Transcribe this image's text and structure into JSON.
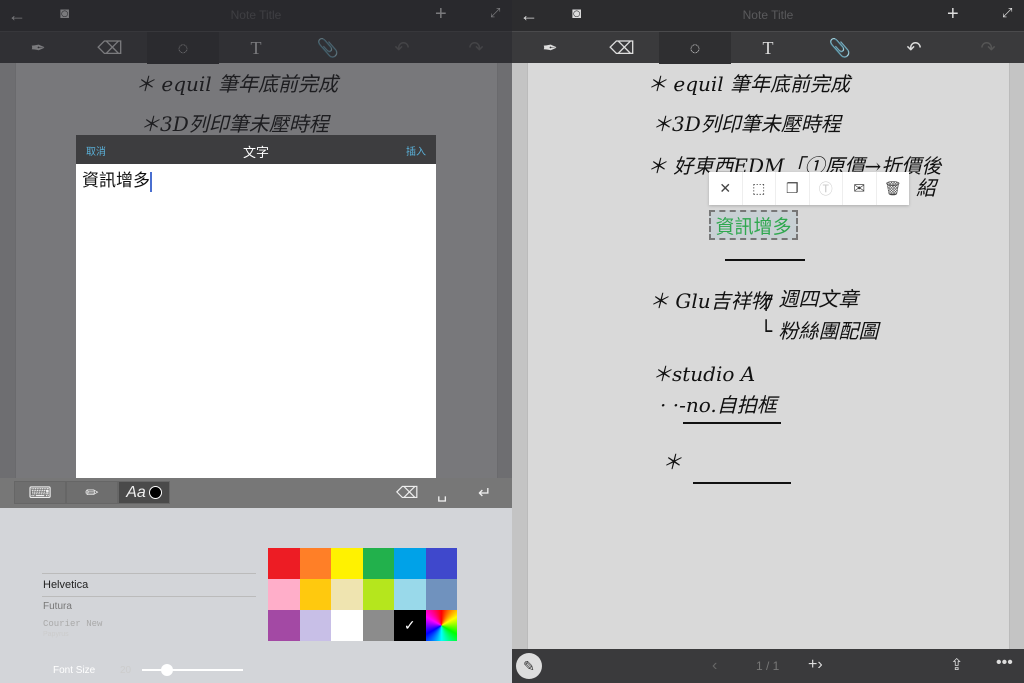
{
  "note_title": "Note Title",
  "toolbar": {
    "tools": [
      "pen-icon",
      "eraser-icon",
      "lasso-icon",
      "text-icon",
      "attach-icon",
      "undo-icon",
      "redo-icon"
    ]
  },
  "handwriting": {
    "line1": "＊ equil 筆年底前完成",
    "line2": "＊3D列印筆未壓時程",
    "line3": "＊ 好東西EDM「①原價→折價後",
    "line3b": "紹",
    "line4": "＊ Glu吉祥物",
    "line4a": "┌ 週四文章",
    "line4b": "└ 粉絲團配圖",
    "line5": "＊studio A",
    "line6": "· ·-no.自拍框",
    "line7": "＊"
  },
  "inserted_text": "資訊增多",
  "dialog": {
    "cancel": "取消",
    "title": "文字",
    "insert": "插入",
    "value": "資訊增多"
  },
  "keyboard_bar": {
    "font_label": "Aa"
  },
  "fonts": [
    "Helvetica",
    "Futura",
    "Courier New",
    "Papyrus"
  ],
  "font_size": {
    "label": "Font Size",
    "value": "20",
    "fraction": 0.25
  },
  "colors": [
    "#ed1c24",
    "#ff7f27",
    "#fff200",
    "#22b14c",
    "#00a2e8",
    "#3f48cc",
    "#ffaec9",
    "#ffc90e",
    "#efe4b0",
    "#b5e61d",
    "#99d9ea",
    "#7092be",
    "#a349a4",
    "#c8bfe7",
    "#ffffff",
    "#8c8c8c",
    "#000000",
    "spectrum"
  ],
  "selected_color": "#000000",
  "selection_menu": [
    "close-icon",
    "resize-icon",
    "copy-icon",
    "convert-text-icon",
    "mail-icon",
    "trash-icon"
  ],
  "pagination": {
    "label": "1 / 1"
  }
}
